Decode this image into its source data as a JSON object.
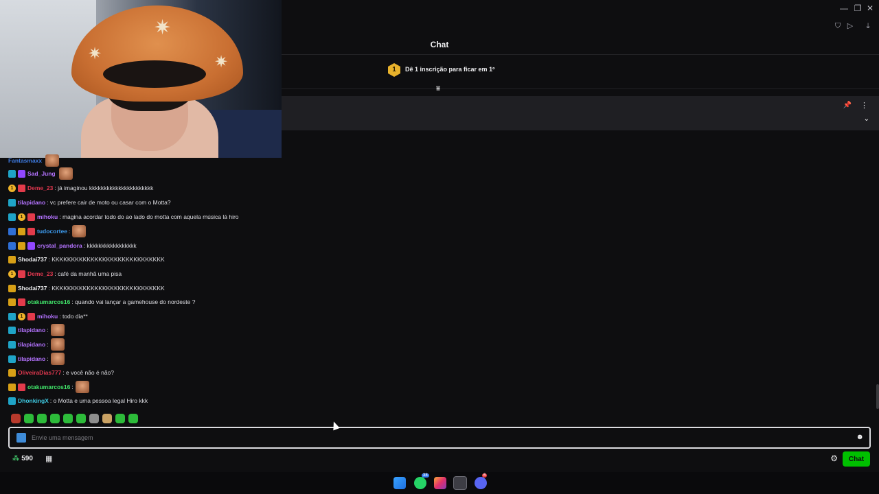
{
  "header": {
    "chat_title": "Chat"
  },
  "leaderboard": {
    "badge_number": "1",
    "text": "Dê 1 inscrição para ficar em 1º"
  },
  "messages": [
    {
      "user": "Fantasmaxx",
      "user_color": "#3d7ae0",
      "text": "",
      "emote": true,
      "badges": []
    },
    {
      "user": "Sad_Jung",
      "user_color": "#b473ff",
      "text": "",
      "emote": true,
      "badges": [
        "prime",
        "sub"
      ]
    },
    {
      "user": "Deme_23",
      "user_color": "#e2384f",
      "text": ": já imaginou kkkkkkkkkkkkkkkkkkkkkk",
      "emote": false,
      "badges": [
        "num",
        "gift"
      ]
    },
    {
      "user": "tilapidano",
      "user_color": "#b473ff",
      "text": ": vc prefere cair de moto ou casar com o Motta?",
      "emote": false,
      "badges": [
        "prime"
      ]
    },
    {
      "user": "mihoku",
      "user_color": "#b473ff",
      "text": ": magina acordar todo do ao lado do motta com aquela música lá hiro",
      "emote": false,
      "badges": [
        "prime",
        "num",
        "gift"
      ]
    },
    {
      "user": "tudocortee",
      "user_color": "#3d9cf0",
      "text": ":",
      "emote": true,
      "badges": [
        "blue",
        "vip",
        "gift"
      ]
    },
    {
      "user": "crystal_pandora",
      "user_color": "#b473ff",
      "text": ": kkkkkkkkkkkkkkkkk",
      "emote": false,
      "badges": [
        "blue",
        "vip",
        "sub"
      ]
    },
    {
      "user": "Shodai737",
      "user_color": "#efeff1",
      "text": ": KKKKKKKKKKKKKKKKKKKKKKKKKKKKK",
      "emote": false,
      "badges": [
        "vip"
      ]
    },
    {
      "user": "Deme_23",
      "user_color": "#e2384f",
      "text": ": café da manhã uma pisa",
      "emote": false,
      "badges": [
        "num",
        "gift"
      ]
    },
    {
      "user": "Shodai737",
      "user_color": "#efeff1",
      "text": ": KKKKKKKKKKKKKKKKKKKKKKKKKKKKK",
      "emote": false,
      "badges": [
        "vip"
      ]
    },
    {
      "user": "otakumarcos16",
      "user_color": "#41e66a",
      "text": ": quando vai lançar a gamehouse do nordeste ?",
      "emote": false,
      "badges": [
        "vip",
        "gift"
      ]
    },
    {
      "user": "mihoku",
      "user_color": "#b473ff",
      "text": ": todo dia**",
      "emote": false,
      "badges": [
        "prime",
        "num",
        "gift"
      ]
    },
    {
      "user": "tilapidano",
      "user_color": "#b473ff",
      "text": ":",
      "emote": true,
      "badges": [
        "prime"
      ]
    },
    {
      "user": "tilapidano",
      "user_color": "#b473ff",
      "text": ":",
      "emote": true,
      "badges": [
        "prime"
      ]
    },
    {
      "user": "tilapidano",
      "user_color": "#b473ff",
      "text": ":",
      "emote": true,
      "badges": [
        "prime"
      ]
    },
    {
      "user": "OliveiraDias777",
      "user_color": "#e2384f",
      "text": ": e você não é não?",
      "emote": false,
      "badges": [
        "vip"
      ]
    },
    {
      "user": "otakumarcos16",
      "user_color": "#41e66a",
      "text": ":",
      "emote": true,
      "badges": [
        "vip",
        "gift"
      ]
    },
    {
      "user": "DhonkingX",
      "user_color": "#3ec8e0",
      "text": ": o Motta e uma pessoa legal Hiro kkk",
      "emote": false,
      "badges": [
        "prime"
      ]
    }
  ],
  "input": {
    "placeholder": "Envie uma mensagem"
  },
  "footer": {
    "points": "590",
    "chat_button": "Chat"
  },
  "taskbar": {
    "whatsapp_badge": "38",
    "discord_badge": "6"
  },
  "colors": {
    "accent": "#9147ff",
    "chat_button": "#00c000",
    "background": "#0e0e10"
  }
}
